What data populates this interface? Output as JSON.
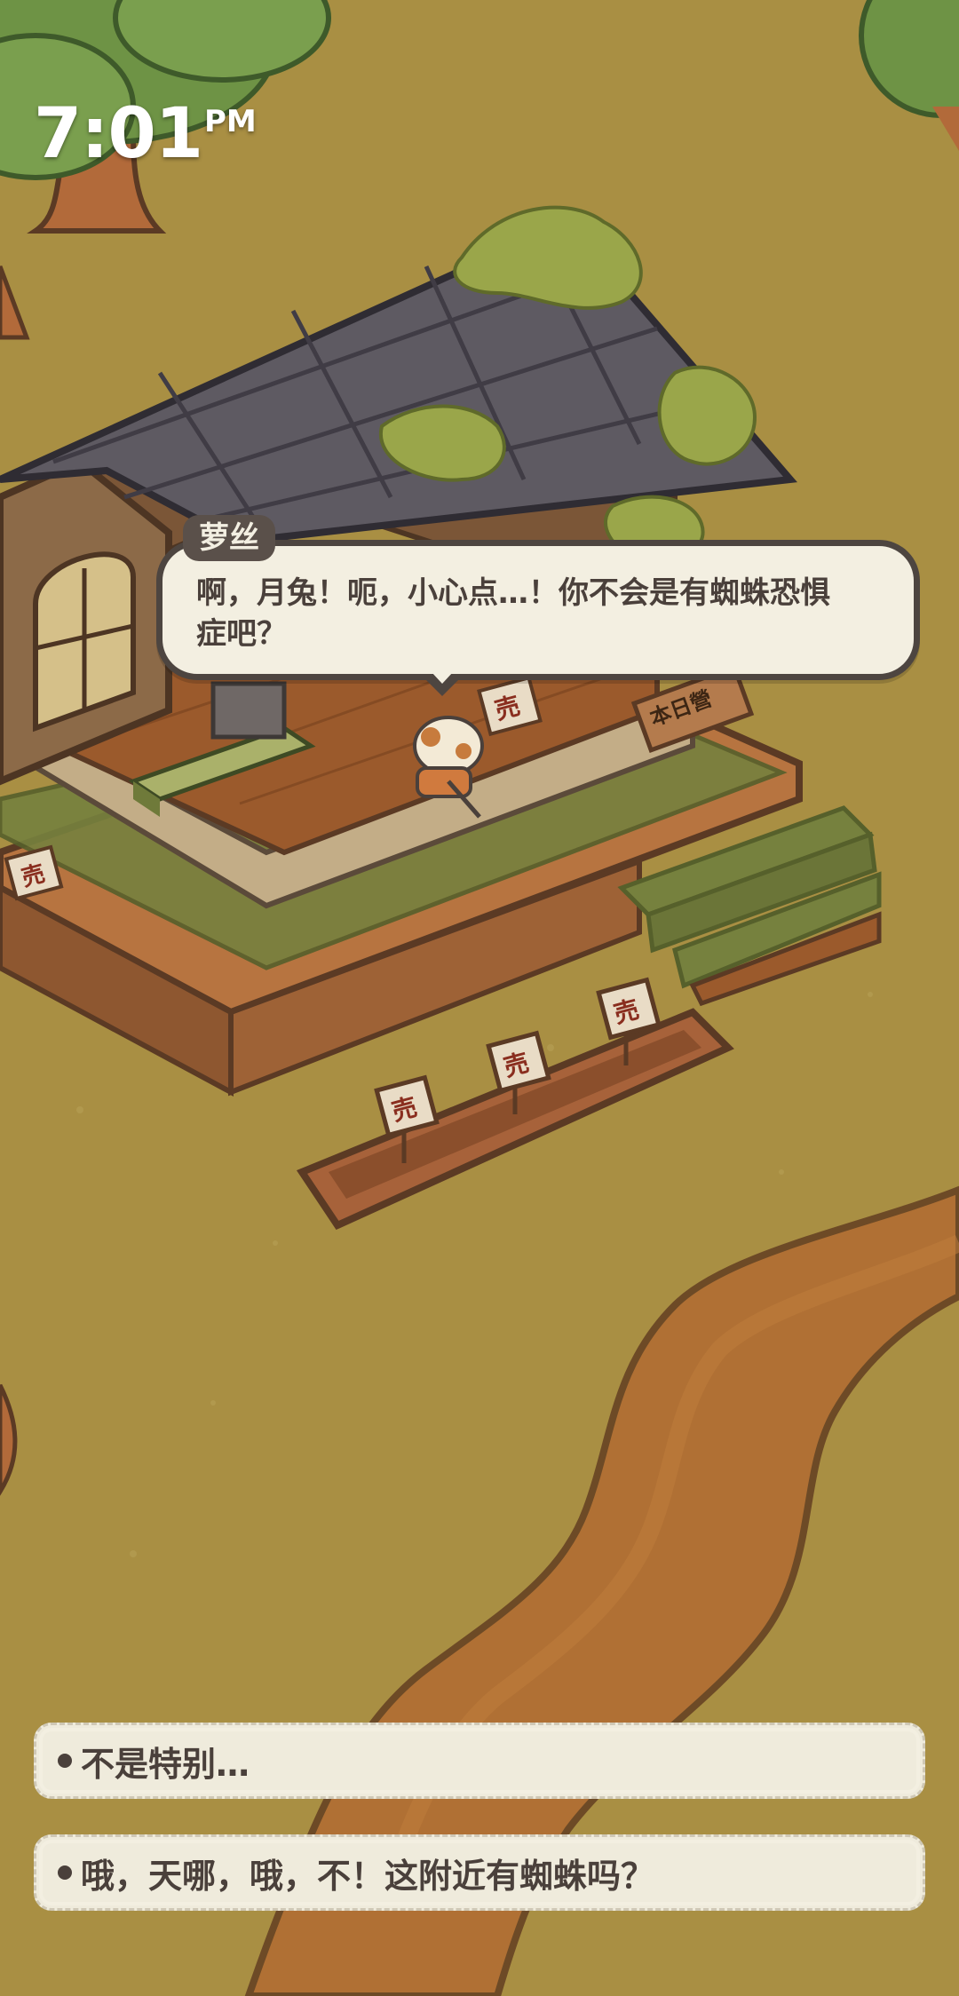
{
  "status": {
    "time": "7:01",
    "ampm": "PM"
  },
  "dialogue": {
    "speaker": "萝丝",
    "text_line1": "啊，月兔！呃，小心点…！你不会是有蜘蛛恐惧",
    "text_line2": "症吧？"
  },
  "choices": [
    {
      "label": "不是特别…"
    },
    {
      "label": "哦，天哪，哦，不！这附近有蜘蛛吗？"
    }
  ],
  "signs": {
    "for_sale": "売",
    "shop_sign": "本日營"
  },
  "colors": {
    "grass": "#a98f43",
    "path": "#b07034",
    "bubble_bg": "#f3efe1",
    "bubble_border": "#4d4540",
    "text": "#4a403b"
  }
}
